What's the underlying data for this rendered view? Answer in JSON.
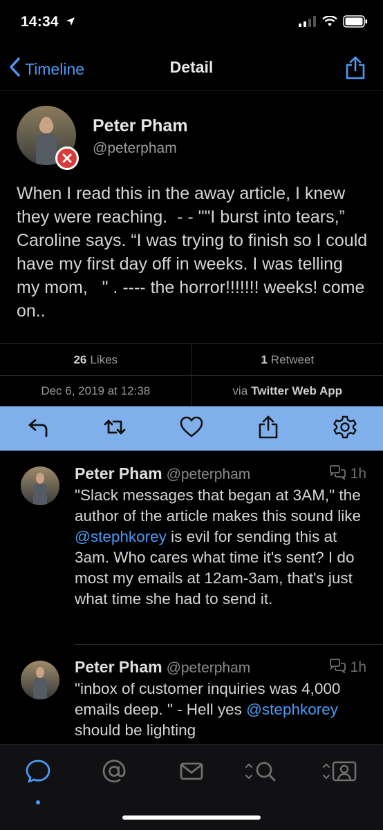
{
  "status": {
    "time": "14:34"
  },
  "nav": {
    "back_label": "Timeline",
    "title": "Detail"
  },
  "tweet": {
    "author_name": "Peter Pham",
    "author_handle": "@peterpham",
    "text": "When I read this in the away article, I knew they were reaching.  - - \"\"I burst into tears,” Caroline says. “I was trying to finish so I could have my first day off in weeks. I was telling my mom,   \" . ---- the horror!!!!!!! weeks! come on..",
    "likes_count": "26",
    "likes_label": "Likes",
    "retweets_count": "1",
    "retweets_label": "Retweet",
    "date": "Dec 6, 2019 at 12:38",
    "via_label": "via",
    "client": "Twitter Web App"
  },
  "replies": [
    {
      "name": "Peter Pham",
      "handle": "@peterpham",
      "time": "1h",
      "text_before": "\"Slack messages that began at 3AM,\" the author of the article makes this sound like ",
      "mention": "@stephkorey",
      "text_after": " is evil for sending this at 3am. Who cares what time it's sent? I do most my emails at 12am-3am, that's just what time she had to send it."
    },
    {
      "name": "Peter Pham",
      "handle": "@peterpham",
      "time": "1h",
      "text_before": "\"inbox of customer inquiries was 4,000 emails deep. \" - Hell yes ",
      "mention": "@stephkorey",
      "text_after": " should be lighting"
    }
  ],
  "icons": {
    "status": [
      "location-arrow-icon",
      "signal-icon",
      "wifi-icon",
      "battery-icon"
    ],
    "nav": [
      "chevron-left-icon",
      "share-icon"
    ],
    "actions": [
      "reply-icon",
      "retweet-icon",
      "like-icon",
      "share-icon",
      "settings-icon"
    ],
    "tabs": [
      "conversation-icon",
      "mentions-icon",
      "messages-icon",
      "search-icon",
      "profile-icon"
    ]
  },
  "colors": {
    "accent": "#4a9bf5",
    "action_bar": "#7fb0ec",
    "error_badge": "#d93a3a"
  }
}
